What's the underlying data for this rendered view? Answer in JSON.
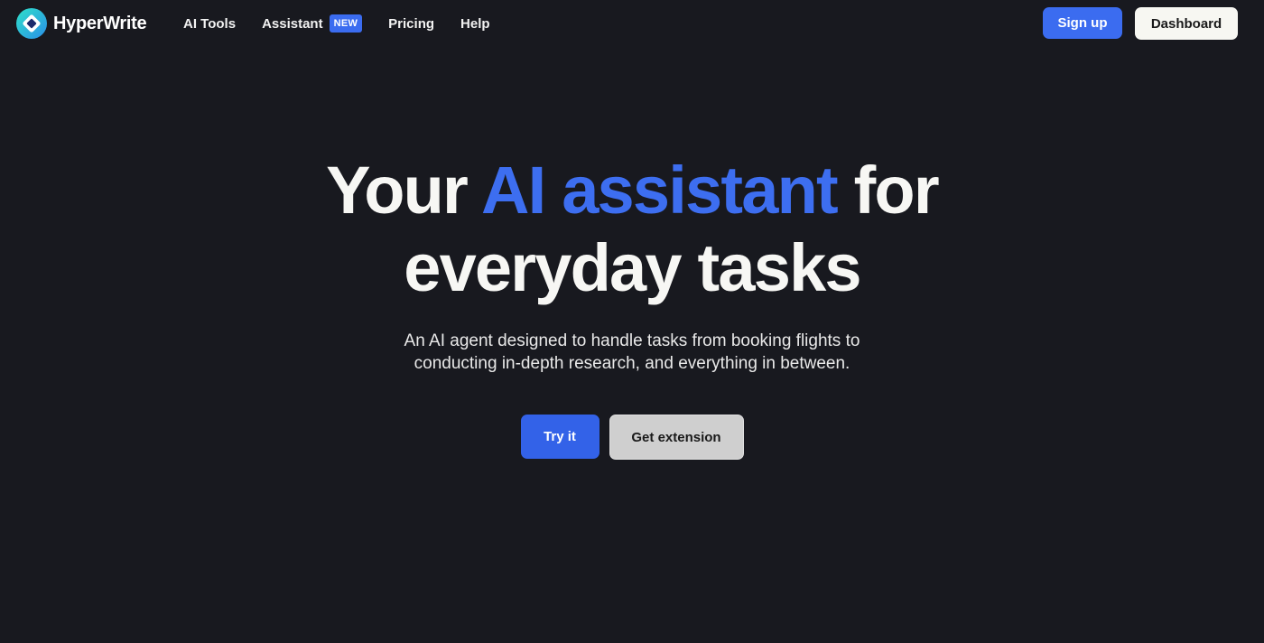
{
  "brand": {
    "name": "HyperWrite",
    "logo_icon": "hyperwrite-logo-icon"
  },
  "nav": {
    "items": [
      {
        "label": "AI Tools"
      },
      {
        "label": "Assistant",
        "badge": "NEW"
      },
      {
        "label": "Pricing"
      },
      {
        "label": "Help"
      }
    ],
    "signup_label": "Sign up",
    "dashboard_label": "Dashboard"
  },
  "hero": {
    "headline_part1": "Your ",
    "headline_accent": "AI assistant",
    "headline_part2": " for",
    "headline_line2": "everyday tasks",
    "subtitle": "An AI agent designed to handle tasks from booking flights to conducting in-depth research, and everything in between.",
    "primary_cta": "Try it",
    "secondary_cta": "Get extension"
  },
  "colors": {
    "background": "#18191f",
    "accent": "#3d6ef0",
    "badge": "#3b6cf0",
    "logo_teal": "#2ad3c8"
  }
}
